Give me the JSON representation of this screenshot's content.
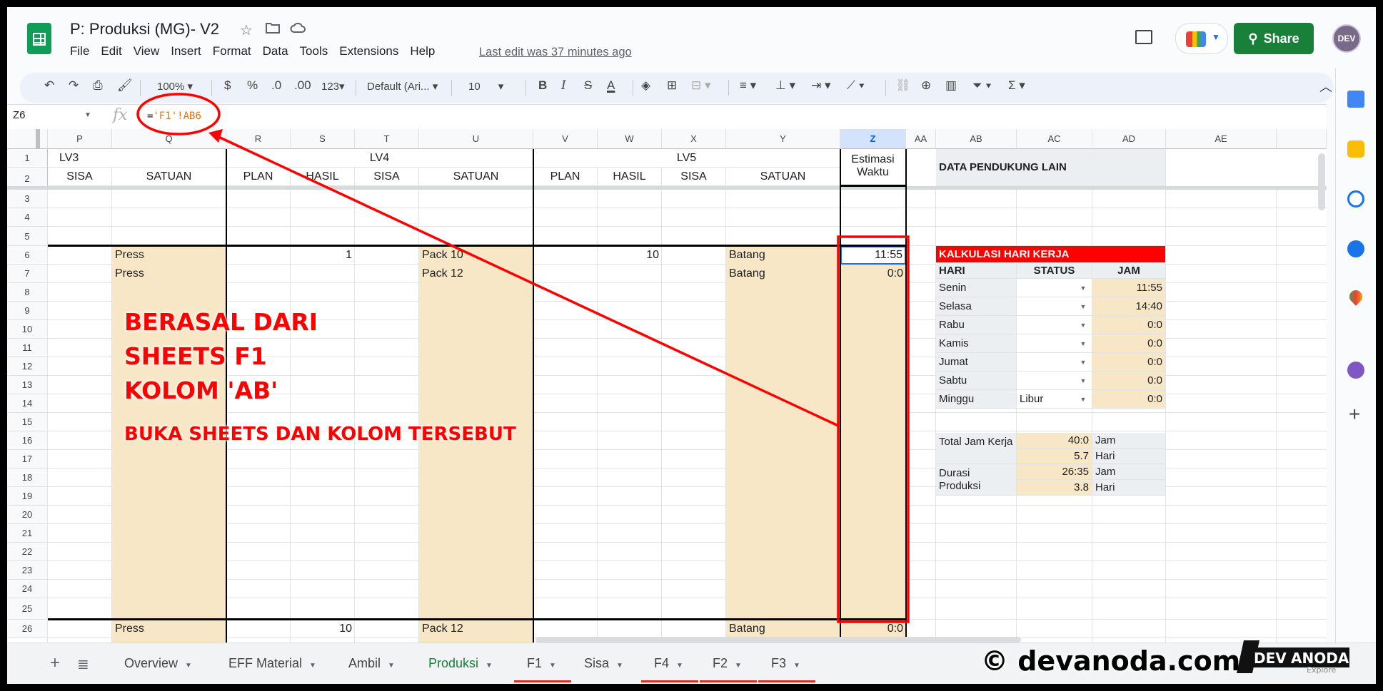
{
  "doc": {
    "title": "P: Produksi (MG)- V2",
    "menu": [
      "File",
      "Edit",
      "View",
      "Insert",
      "Format",
      "Data",
      "Tools",
      "Extensions",
      "Help"
    ],
    "last_edit": "Last edit was 37 minutes ago",
    "share_label": "Share",
    "avatar_text": "DEV"
  },
  "toolbar": {
    "zoom": "100%",
    "currency": "$",
    "percent": "%",
    "dec_decrease": ".0",
    "dec_increase": ".00",
    "more_formats": "123",
    "font": "Default (Ari...",
    "font_size": "10"
  },
  "formula_bar": {
    "cell_ref": "Z6",
    "fx": "fx",
    "formula_prefix": "=",
    "formula_ref": "'F1'!AB6"
  },
  "columns": [
    "P",
    "Q",
    "R",
    "S",
    "T",
    "U",
    "V",
    "W",
    "X",
    "Y",
    "Z",
    "AA",
    "AB",
    "AC",
    "AD",
    "AE"
  ],
  "header": {
    "lv3": "LV3",
    "lv4": "LV4",
    "lv5": "LV5",
    "sisa": "SISA",
    "satuan": "SATUAN",
    "plan": "PLAN",
    "hasil": "HASIL",
    "estimasi": "Estimasi Waktu",
    "data_pendukung": "DATA PENDUKUNG LAIN"
  },
  "rows": {
    "r6": {
      "q": "Press",
      "s": "1",
      "u": "Pack 10",
      "w": "10",
      "y": "Batang",
      "z": "11:55"
    },
    "r7": {
      "q": "Press",
      "u": "Pack 12",
      "y": "Batang",
      "z": "0:0"
    },
    "r26": {
      "q": "Press",
      "s": "10",
      "u": "Pack 12",
      "y": "Batang",
      "z": "0:0"
    }
  },
  "kalkulasi": {
    "title": "KALKULASI HARI KERJA",
    "hdr_hari": "HARI",
    "hdr_status": "STATUS",
    "hdr_jam": "JAM",
    "days": [
      {
        "hari": "Senin",
        "status": "",
        "jam": "11:55"
      },
      {
        "hari": "Selasa",
        "status": "",
        "jam": "14:40"
      },
      {
        "hari": "Rabu",
        "status": "",
        "jam": "0:0"
      },
      {
        "hari": "Kamis",
        "status": "",
        "jam": "0:0"
      },
      {
        "hari": "Jumat",
        "status": "",
        "jam": "0:0"
      },
      {
        "hari": "Sabtu",
        "status": "",
        "jam": "0:0"
      },
      {
        "hari": "Minggu",
        "status": "Libur",
        "jam": "0:0"
      }
    ],
    "total_label": "Total Jam Kerja",
    "total_jam": "40:0",
    "total_jam_unit": "Jam",
    "total_hari": "5.7",
    "total_hari_unit": "Hari",
    "durasi_label": "Durasi Produksi",
    "durasi_jam": "26:35",
    "durasi_jam_unit": "Jam",
    "durasi_hari": "3.8",
    "durasi_hari_unit": "Hari"
  },
  "annotation": {
    "line1": "BERASAL DARI",
    "line2": "SHEETS F1",
    "line3": "KOLOM 'AB'",
    "line4": "BUKA SHEETS DAN KOLOM TERSEBUT",
    "color": "#ff0000"
  },
  "tabs": [
    {
      "label": "Overview"
    },
    {
      "label": "EFF Material"
    },
    {
      "label": "Ambil"
    },
    {
      "label": "Produksi"
    },
    {
      "label": "F1"
    },
    {
      "label": "Sisa"
    },
    {
      "label": "F4"
    },
    {
      "label": "F2"
    },
    {
      "label": "F3"
    }
  ],
  "watermark": {
    "text": "© devanoda.com",
    "logo_left": "DEV",
    "logo_right": "ANODA",
    "logo_sub": "Explore"
  },
  "colors": {
    "accent_green": "#188038",
    "tan_fill": "#f7e7c6",
    "kalkulasi_red": "#ff0000"
  }
}
